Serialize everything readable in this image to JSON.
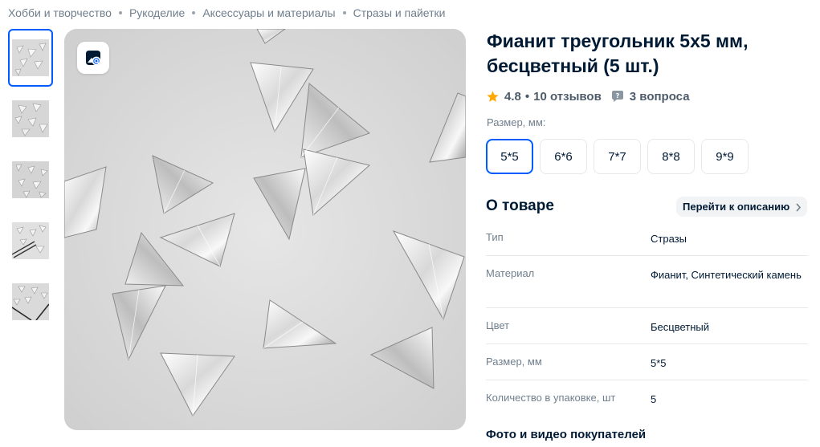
{
  "breadcrumb": [
    "Хобби и творчество",
    "Рукоделие",
    "Аксессуары и материалы",
    "Стразы и пайетки"
  ],
  "product": {
    "title": "Фианит треугольник 5x5 мм, бесцветный (5 шт.)",
    "rating": "4.8",
    "reviews": "10 отзывов",
    "questions": "3 вопроса"
  },
  "size_selector": {
    "label": "Размер, мм:",
    "options": [
      "5*5",
      "6*6",
      "7*7",
      "8*8",
      "9*9"
    ],
    "selected": "5*5"
  },
  "about": {
    "title": "О товаре",
    "goto_label": "Перейти к описанию",
    "specs": [
      {
        "name": "Тип",
        "value": "Стразы"
      },
      {
        "name": "Материал",
        "value": "Фианит, Синтетический камень"
      },
      {
        "name": "Цвет",
        "value": "Бесцветный"
      },
      {
        "name": "Размер, мм",
        "value": "5*5"
      },
      {
        "name": "Количество в упаковке, шт",
        "value": "5"
      }
    ]
  },
  "photos_section_title": "Фото и видео покупателей",
  "gallery": {
    "thumbnail_count": 5,
    "active_index": 0,
    "zoom_icon": "image-search-icon"
  },
  "colors": {
    "accent": "#005bff",
    "star": "#ffa800",
    "text_primary": "#001a34",
    "text_secondary": "#707f8d"
  }
}
